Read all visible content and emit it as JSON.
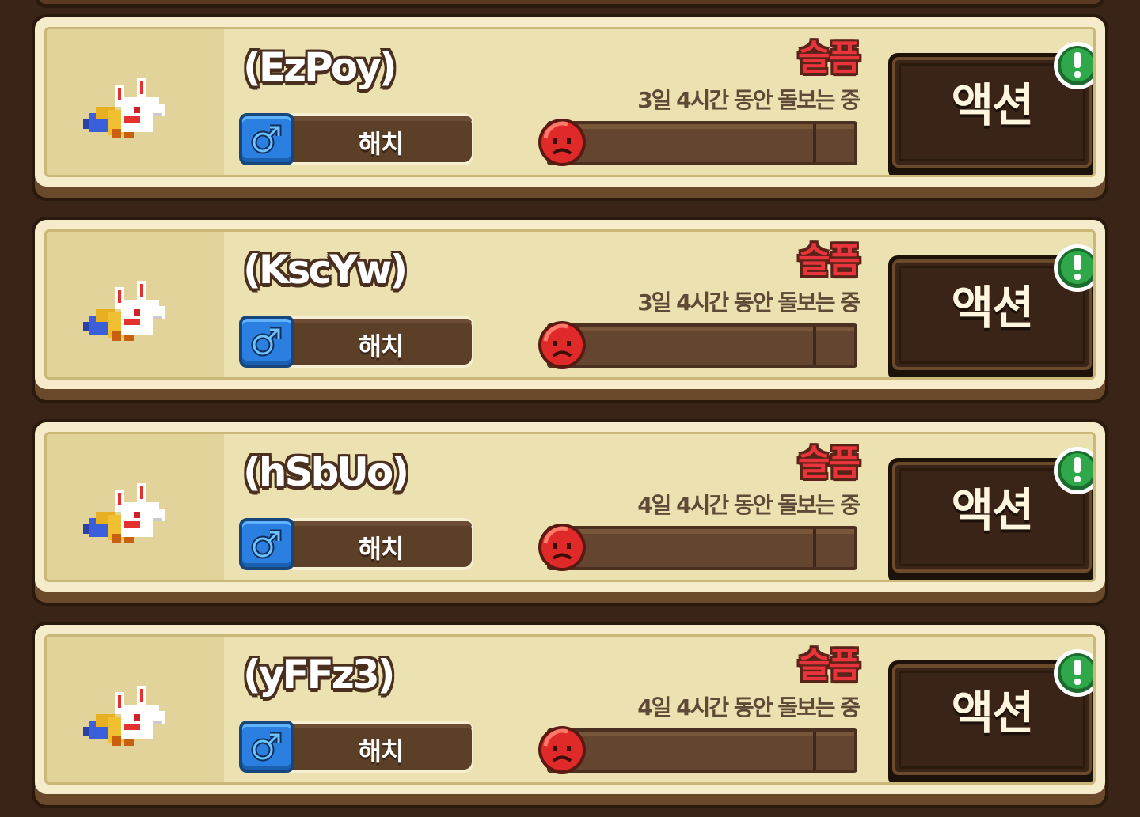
{
  "pets": [
    {
      "name": "(EzPoy)",
      "gender_label": "해치",
      "status": "슬픔",
      "care_time": "3일 4시간 동안 돌보는 중",
      "action_label": "액션",
      "mood_level": 0
    },
    {
      "name": "(KscYw)",
      "gender_label": "해치",
      "status": "슬픔",
      "care_time": "3일 4시간 동안 돌보는 중",
      "action_label": "액션",
      "mood_level": 0
    },
    {
      "name": "(hSbUo)",
      "gender_label": "해치",
      "status": "슬픔",
      "care_time": "4일 4시간 동안 돌보는 중",
      "action_label": "액션",
      "mood_level": 0
    },
    {
      "name": "(yFFz3)",
      "gender_label": "해치",
      "status": "슬픔",
      "care_time": "4일 4시간 동안 돌보는 중",
      "action_label": "액션",
      "mood_level": 0
    }
  ],
  "icons": {
    "gender": "male-symbol-icon",
    "mood": "sad-face-icon",
    "alert": "exclamation-icon",
    "pet": "fox-pet-sprite"
  },
  "colors": {
    "status_sad": "#e8353b",
    "male_blue": "#2a7fe0",
    "alert_green": "#2fa84a",
    "card_bg": "#ece1b0"
  }
}
